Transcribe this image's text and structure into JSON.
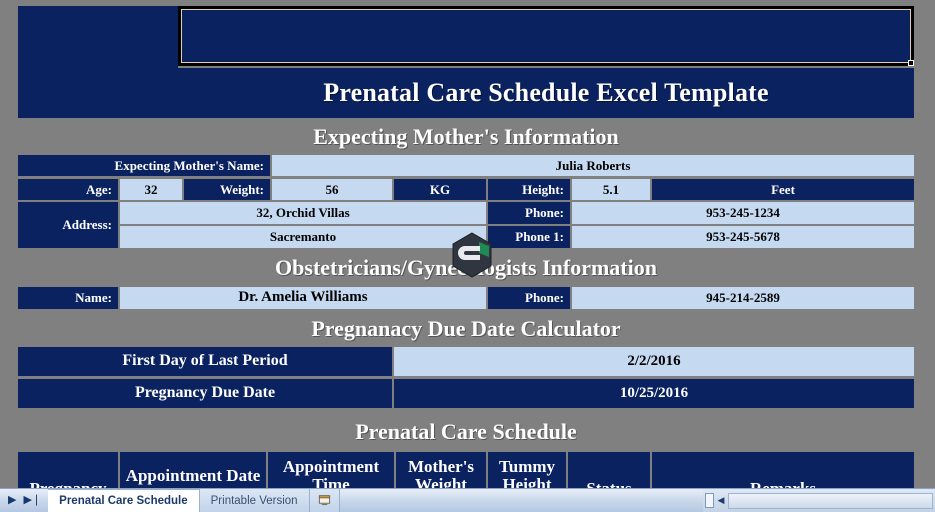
{
  "document": {
    "banner_title": "Prenatal Care Schedule Excel Template"
  },
  "sections": {
    "mother_info_title": "Expecting Mother's Information",
    "ob_info_title": "Obstetricians/Gynecologists Information",
    "due_date_title": "Pregnanacy Due Date Calculator",
    "schedule_title": "Prenatal Care Schedule"
  },
  "mother": {
    "name_label": "Expecting Mother's Name:",
    "name_value": "Julia Roberts",
    "age_label": "Age:",
    "age_value": "32",
    "weight_label": "Weight:",
    "weight_value": "56",
    "weight_unit": "KG",
    "height_label": "Height:",
    "height_value": "5.1",
    "height_unit": "Feet",
    "address_label": "Address:",
    "address_line1": "32, Orchid Villas",
    "address_line2": "Sacremanto",
    "phone_label": "Phone:",
    "phone_value": "953-245-1234",
    "phone1_label": "Phone 1:",
    "phone1_value": "953-245-5678"
  },
  "obstetrician": {
    "name_label": "Name:",
    "name_value": "Dr. Amelia Williams",
    "phone_label": "Phone:",
    "phone_value": "945-214-2589"
  },
  "due_date": {
    "lmp_label": "First Day of Last Period",
    "lmp_value": "2/2/2016",
    "due_label": "Pregnancy Due Date",
    "due_value": "10/25/2016"
  },
  "schedule_table": {
    "columns": [
      "Pregnancy",
      "Appointment Date",
      "Appointment Time",
      "Mother's Weight",
      "Tummy Height",
      "Status",
      "Remarks"
    ]
  },
  "tabbar": {
    "nav_next": "▶",
    "nav_last": "▶❘",
    "tabs": [
      {
        "label": "Prenatal Care Schedule",
        "active": true
      },
      {
        "label": "Printable Version",
        "active": false
      }
    ],
    "new_sheet_label": "",
    "scroll_left_arrow": "◀"
  },
  "colors": {
    "navy": "#0a2260",
    "light_blue": "#c5d9f1",
    "gray": "#808080",
    "white": "#ffffff",
    "active_cell_border": "#000000",
    "active_cell_inner": "#e8cf9a"
  }
}
